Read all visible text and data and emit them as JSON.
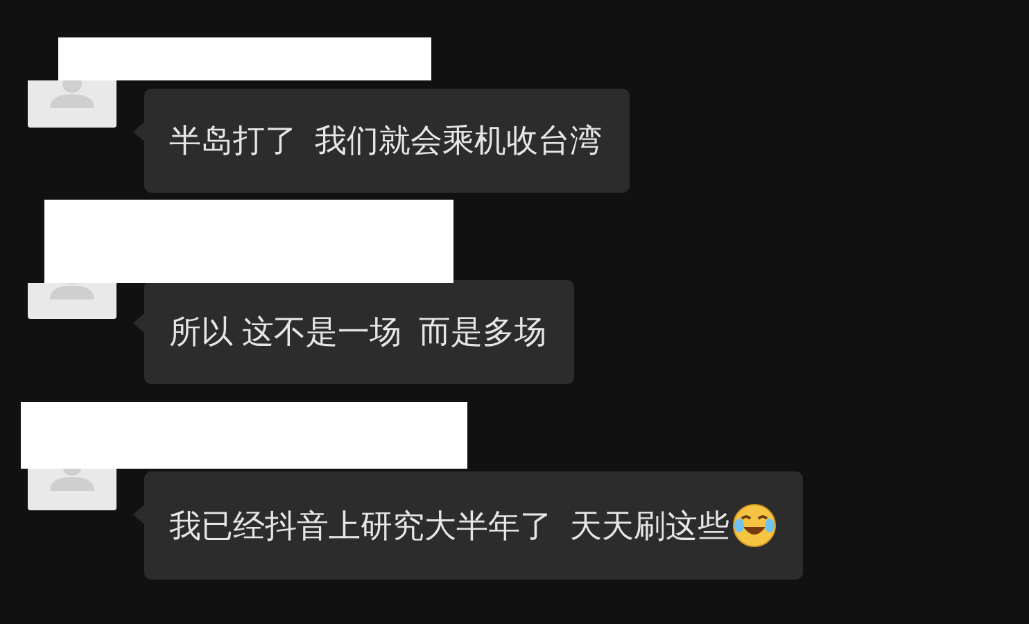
{
  "messages": [
    {
      "text": "半岛打了  我们就会乘机收台湾",
      "emoji": false
    },
    {
      "text": "所以 这不是一场  而是多场",
      "emoji": false
    },
    {
      "text": "我已经抖音上研究大半年了  天天刷这些",
      "emoji": true
    }
  ]
}
